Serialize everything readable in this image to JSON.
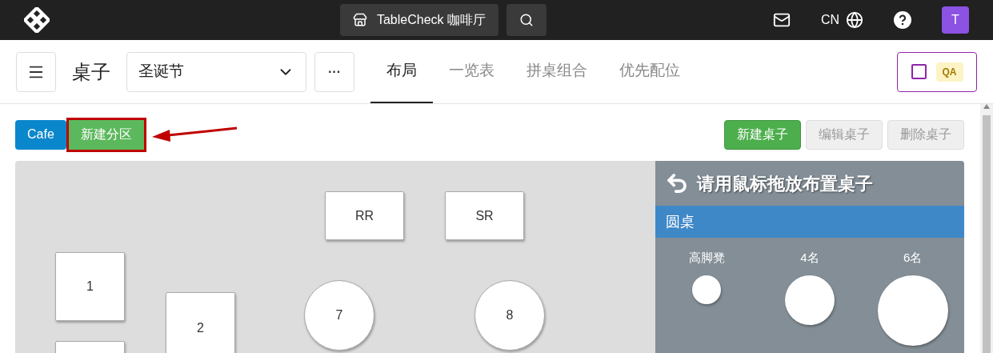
{
  "top_bar": {
    "venue": "TableCheck 咖啡厅",
    "language": "CN",
    "avatar": "T"
  },
  "header": {
    "title": "桌子",
    "event_select": "圣诞节",
    "more": "···",
    "tabs": [
      {
        "label": "布局",
        "selected": true
      },
      {
        "label": "一览表",
        "selected": false
      },
      {
        "label": "拼桌组合",
        "selected": false
      },
      {
        "label": "优先配位",
        "selected": false
      }
    ],
    "qa": {
      "label": "QA",
      "checked": false
    }
  },
  "sections": [
    {
      "label": "Cafe",
      "kind": "section",
      "highlighted": false
    },
    {
      "label": "新建分区",
      "kind": "new",
      "highlighted": true
    }
  ],
  "actions": [
    {
      "label": "新建桌子",
      "disabled": false
    },
    {
      "label": "编辑桌子",
      "disabled": true
    },
    {
      "label": "删除桌子",
      "disabled": true
    }
  ],
  "tables": [
    {
      "label": "RR",
      "kind": "rect"
    },
    {
      "label": "SR",
      "kind": "rect"
    },
    {
      "label": "1",
      "kind": "rect"
    },
    {
      "label": "2",
      "kind": "rect"
    },
    {
      "label": "7",
      "kind": "round"
    },
    {
      "label": "8",
      "kind": "round"
    },
    {
      "kind": "rect"
    }
  ],
  "palette": {
    "title": "请用鼠标拖放布置桌子",
    "category": "圆桌",
    "items": [
      {
        "label": "高脚凳"
      },
      {
        "label": "4名"
      },
      {
        "label": "6名"
      }
    ]
  }
}
